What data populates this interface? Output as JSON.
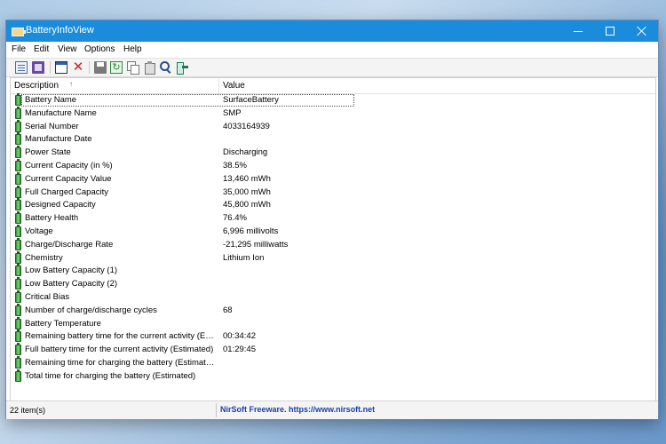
{
  "window": {
    "title": "BatteryInfoView",
    "accent_color": "#1b8cdb",
    "controls": {
      "minimize": "minimize-icon",
      "maximize": "maximize-icon",
      "close": "close-icon"
    }
  },
  "menu": {
    "file": "File",
    "edit": "Edit",
    "view": "View",
    "options": "Options",
    "help": "Help"
  },
  "toolbar": {
    "icons": [
      "properties-icon",
      "html-report-icon",
      "window-icon",
      "delete-icon",
      "save-icon",
      "refresh-icon",
      "copy-icon",
      "paste-icon",
      "find-icon",
      "exit-icon"
    ]
  },
  "list": {
    "columns": {
      "description": "Description",
      "value": "Value"
    },
    "sort_indicator": "↑",
    "rows": [
      {
        "description": "Battery Name",
        "value": "SurfaceBattery"
      },
      {
        "description": "Manufacture Name",
        "value": "SMP"
      },
      {
        "description": "Serial Number",
        "value": "4033164939"
      },
      {
        "description": "Manufacture Date",
        "value": ""
      },
      {
        "description": "Power State",
        "value": "Discharging"
      },
      {
        "description": "Current Capacity (in %)",
        "value": "38.5%"
      },
      {
        "description": "Current Capacity Value",
        "value": "13,460 mWh"
      },
      {
        "description": "Full Charged Capacity",
        "value": "35,000 mWh"
      },
      {
        "description": "Designed Capacity",
        "value": "45,800 mWh"
      },
      {
        "description": "Battery Health",
        "value": "76.4%"
      },
      {
        "description": "Voltage",
        "value": "6,996 millivolts"
      },
      {
        "description": "Charge/Discharge Rate",
        "value": "-21,295 milliwatts"
      },
      {
        "description": "Chemistry",
        "value": "Lithium Ion"
      },
      {
        "description": "Low Battery Capacity (1)",
        "value": ""
      },
      {
        "description": "Low Battery Capacity (2)",
        "value": ""
      },
      {
        "description": "Critical Bias",
        "value": ""
      },
      {
        "description": "Number of charge/discharge cycles",
        "value": "68"
      },
      {
        "description": "Battery Temperature",
        "value": ""
      },
      {
        "description": "Remaining battery time for the current activity (Est...",
        "value": "00:34:42"
      },
      {
        "description": "Full battery time for the current activity (Estimated)",
        "value": "01:29:45"
      },
      {
        "description": "Remaining time for charging the battery (Estimated)",
        "value": ""
      },
      {
        "description": "Total  time for charging the battery (Estimated)",
        "value": ""
      }
    ]
  },
  "status": {
    "count": "22 item(s)",
    "link": "NirSoft Freeware. https://www.nirsoft.net"
  }
}
